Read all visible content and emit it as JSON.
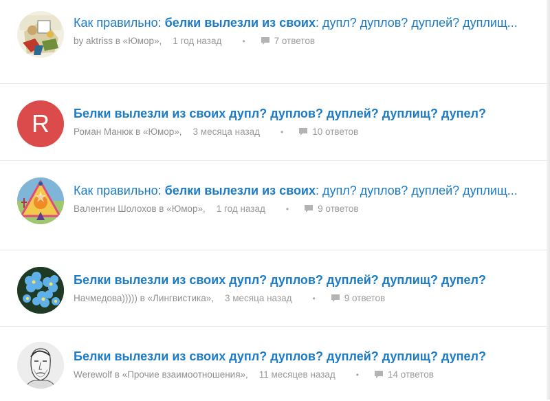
{
  "items": [
    {
      "title_prefix": "Как правильно: ",
      "title_bold": "белки вылезли из своих",
      "title_rest": ": дупл? дуплов? дуплей? дуплищ...",
      "author": "by aktriss в «Юмор»,",
      "time": "1 год назад",
      "answers": "7 ответов",
      "avatar": "cartoon-avatar"
    },
    {
      "title_prefix": "",
      "title_bold": "Белки вылезли из своих дупл? дуплов? дуплей? дуплищ? дупел?",
      "title_rest": "",
      "author": "Роман Манюк в «Юмор»,",
      "time": "3 месяца назад",
      "answers": "10 ответов",
      "avatar": "letter-avatar",
      "avatar_letter": "R"
    },
    {
      "title_prefix": "Как правильно: ",
      "title_bold": "белки вылезли из своих",
      "title_rest": ": дупл? дуплов? дуплей? дуплищ...",
      "author": "Валентин Шолохов в «Юмор»,",
      "time": "1 год назад",
      "answers": "9 ответов",
      "avatar": "symbol-avatar"
    },
    {
      "title_prefix": "",
      "title_bold": "Белки вылезли из своих дупл? дуплов? дуплей? дуплищ? дупел?",
      "title_rest": "",
      "author": "Начмедова))))) в «Лингвистика»,",
      "time": "3 месяца назад",
      "answers": "9 ответов",
      "avatar": "flowers-avatar"
    },
    {
      "title_prefix": "",
      "title_bold": "Белки вылезли из своих дупл? дуплов? дуплей? дуплищ? дупел?",
      "title_rest": "",
      "author": "Werewolf в «Прочие взаимоотношения»,",
      "time": "11 месяцев назад",
      "answers": "14 ответов",
      "avatar": "sketch-avatar"
    }
  ],
  "colors": {
    "link": "#1c7bc7",
    "meta": "#9a9a9a",
    "letter_avatar_bg": "#dc4b4b",
    "divider": "#e6e6e6"
  },
  "icons": {
    "comment": "comment-icon",
    "bullet": "•"
  }
}
